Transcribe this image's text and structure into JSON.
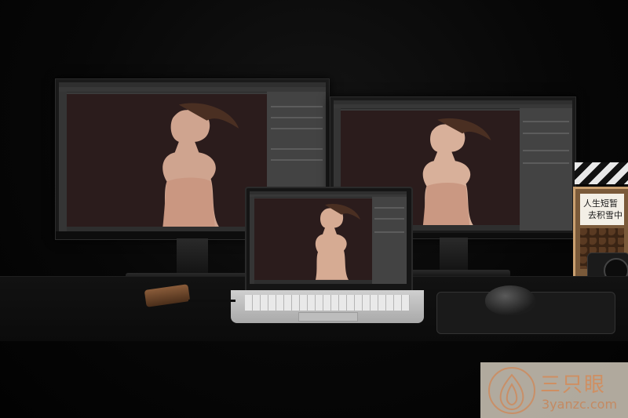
{
  "scene": {
    "description_tags": [
      "left-monitor",
      "right-monitor",
      "laptop",
      "mouse",
      "mousepad",
      "usb-adapter",
      "camera",
      "calligraphy-sign"
    ]
  },
  "sign": {
    "line1": "人生短暂",
    "line2": "去积雪中"
  },
  "watermark": {
    "title": "三只眼",
    "url": "3yanzc.com"
  },
  "colors": {
    "background": "#050505",
    "photoshop_canvas": "#2b1c1c",
    "watermark_accent": "#cf8f62"
  }
}
